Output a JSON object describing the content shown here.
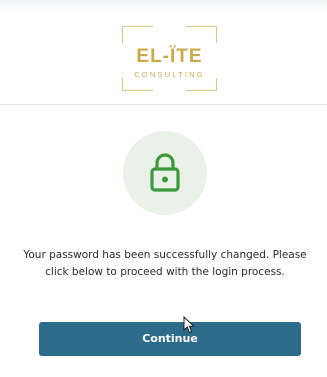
{
  "header": {
    "logo": {
      "main_text": "EL-ÏTE",
      "sub_text": "CONSULTING"
    }
  },
  "main": {
    "icon": "lock-icon",
    "message": "Your password has been successfully changed. Please click below to proceed with the login process.",
    "continue_label": "Continue"
  },
  "colors": {
    "brand_gold": "#c9a94c",
    "button_blue": "#2d6b8a",
    "lock_green": "#3c9a3a",
    "circle_bg": "#eaf1e8"
  }
}
